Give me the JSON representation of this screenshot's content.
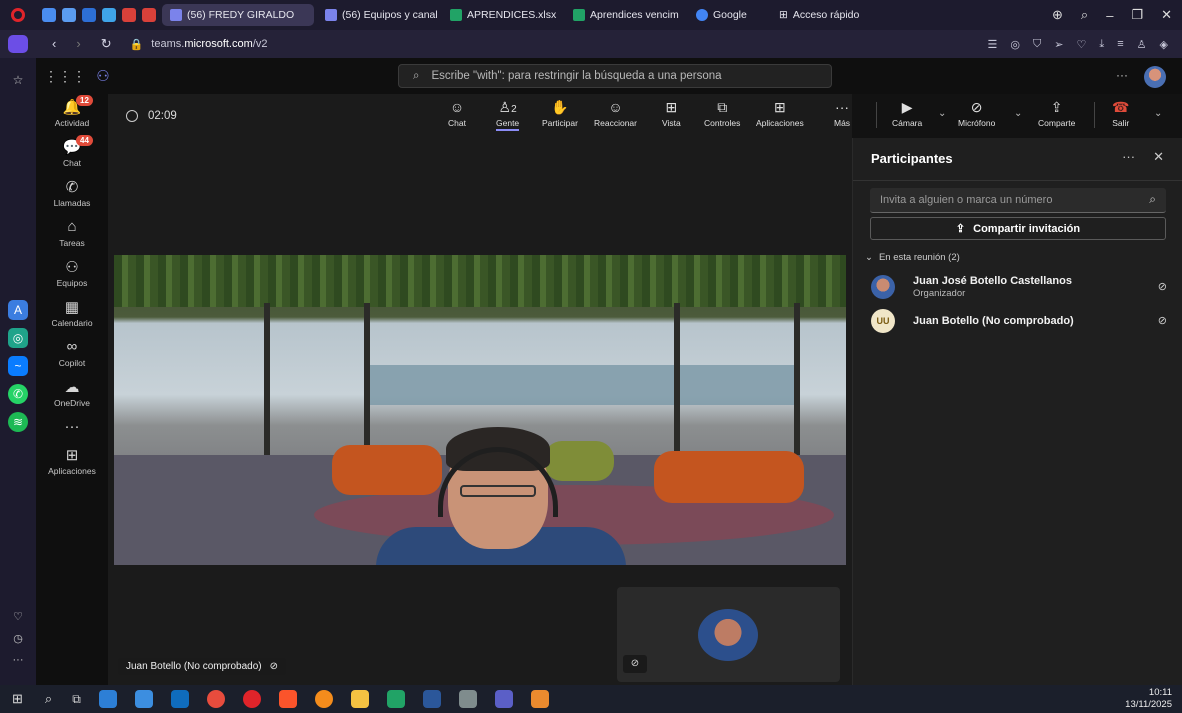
{
  "browser": {
    "tabs": [
      {
        "label": "(56) FREDY GIRALDO",
        "active": true,
        "color": "#7b83eb"
      },
      {
        "label": "(56) Equipos y canal",
        "active": false,
        "color": "#7b83eb"
      },
      {
        "label": "APRENDICES.xlsx",
        "active": false,
        "color": "#21a366"
      },
      {
        "label": "Aprendices vencim",
        "active": false,
        "color": "#21a366"
      },
      {
        "label": "Google",
        "active": false,
        "color": "#4285f4"
      }
    ],
    "quick_access": "Acceso rápido",
    "url_prefix": "teams.",
    "url_host": "microsoft.com",
    "url_path": "/v2"
  },
  "teams": {
    "search_placeholder": "Escribe \"with\": para restringir la búsqueda a una persona",
    "rail": [
      {
        "label": "Actividad",
        "icon": "bell-icon",
        "glyph": "🔔",
        "badge": "12"
      },
      {
        "label": "Chat",
        "icon": "chat-icon",
        "glyph": "💬",
        "badge": "44"
      },
      {
        "label": "Llamadas",
        "icon": "phone-icon",
        "glyph": "✆",
        "badge": ""
      },
      {
        "label": "Tareas",
        "icon": "tasks-icon",
        "glyph": "⌂",
        "badge": ""
      },
      {
        "label": "Equipos",
        "icon": "teams-icon",
        "glyph": "⚇",
        "badge": ""
      },
      {
        "label": "Calendario",
        "icon": "calendar-icon",
        "glyph": "▦",
        "badge": ""
      },
      {
        "label": "Copilot",
        "icon": "copilot-icon",
        "glyph": "∞",
        "badge": ""
      },
      {
        "label": "OneDrive",
        "icon": "cloud-icon",
        "glyph": "☁",
        "badge": ""
      },
      {
        "label": "",
        "icon": "more-icon",
        "glyph": "···",
        "badge": ""
      },
      {
        "label": "Aplicaciones",
        "icon": "apps-icon",
        "glyph": "⊞",
        "badge": ""
      }
    ]
  },
  "meeting": {
    "timer": "02:09",
    "controls": {
      "chat": "Chat",
      "people": "Gente",
      "people_count": "2",
      "raise": "Participar",
      "react": "Reaccionar",
      "view": "Vista",
      "controls": "Controles",
      "apps": "Aplicaciones",
      "more": "Más",
      "camera": "Cámara",
      "mic": "Micrófono",
      "share": "Comparte",
      "leave": "Salir"
    },
    "speaker_name": "Juan Botello (No comprobado)"
  },
  "participants_panel": {
    "title": "Participantes",
    "invite_placeholder": "Invita a alguien o marca un número",
    "share_invite": "Compartir invitación",
    "section_label": "En esta reunión (2)",
    "people": [
      {
        "name": "Juan José Botello Castellanos",
        "role": "Organizador",
        "initials": ""
      },
      {
        "name": "Juan Botello (No comprobado)",
        "role": "",
        "initials": "UU"
      }
    ]
  },
  "taskbar": {
    "time": "10:11",
    "date": "13/11/2025"
  }
}
